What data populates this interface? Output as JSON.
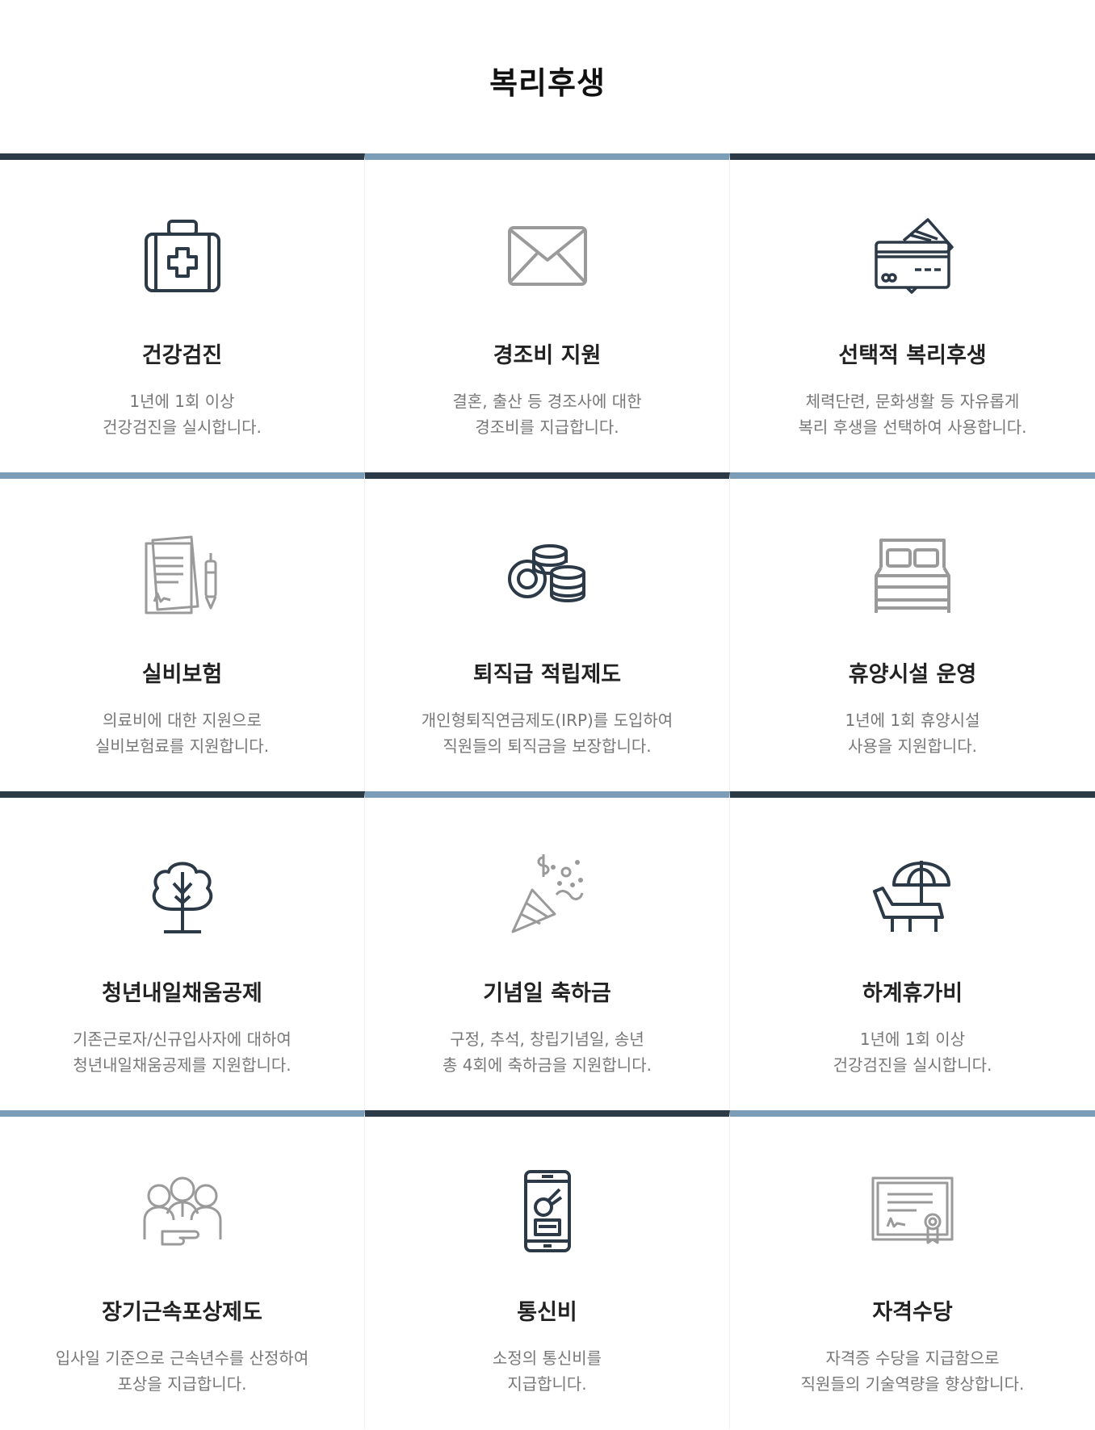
{
  "page": {
    "title": "복리후생"
  },
  "colors": {
    "dark_bar": "#2c3947",
    "light_bar": "#7b9db7",
    "dark_icon": "#2c3947",
    "light_icon": "#9a9a9a"
  },
  "benefits": [
    {
      "icon": "first-aid-kit-icon",
      "title": "건강검진",
      "desc1": "1년에 1회 이상",
      "desc2": "건강검진을 실시합니다."
    },
    {
      "icon": "envelope-icon",
      "title": "경조비 지원",
      "desc1": "결혼, 출산 등 경조사에 대한",
      "desc2": "경조비를 지급합니다."
    },
    {
      "icon": "credit-card-icon",
      "title": "선택적 복리후생",
      "desc1": "체력단련, 문화생활 등 자유롭게",
      "desc2": "복리 후생을 선택하여 사용합니다."
    },
    {
      "icon": "contract-pen-icon",
      "title": "실비보험",
      "desc1": "의료비에 대한 지원으로",
      "desc2": "실비보험료를 지원합니다."
    },
    {
      "icon": "coins-icon",
      "title": "퇴직급 적립제도",
      "desc1": "개인형퇴직연금제도(IRP)를 도입하여",
      "desc2": "직원들의 퇴직금을 보장합니다."
    },
    {
      "icon": "bed-icon",
      "title": "휴양시설 운영",
      "desc1": "1년에 1회 휴양시설",
      "desc2": "사용을 지원합니다."
    },
    {
      "icon": "tree-icon",
      "title": "청년내일채움공제",
      "desc1": "기존근로자/신규입사자에 대하여",
      "desc2": "청년내일채움공제를 지원합니다."
    },
    {
      "icon": "party-popper-icon",
      "title": "기념일 축하금",
      "desc1": "구정, 추석, 창립기념일, 송년",
      "desc2": "총 4회에 축하금을 지원합니다."
    },
    {
      "icon": "beach-chair-umbrella-icon",
      "title": "하계휴가비",
      "desc1": "1년에 1회 이상",
      "desc2": "건강검진을 실시합니다."
    },
    {
      "icon": "team-handshake-icon",
      "title": "장기근속포상제도",
      "desc1": "입사일 기준으로 근속년수를 산정하여",
      "desc2": "포상을 지급합니다."
    },
    {
      "icon": "smartphone-icon",
      "title": "통신비",
      "desc1": "소정의 통신비를",
      "desc2": "지급합니다."
    },
    {
      "icon": "certificate-icon",
      "title": "자격수당",
      "desc1": "자격증 수당을 지급함으로",
      "desc2": "직원들의 기술역량을 향상합니다."
    }
  ]
}
